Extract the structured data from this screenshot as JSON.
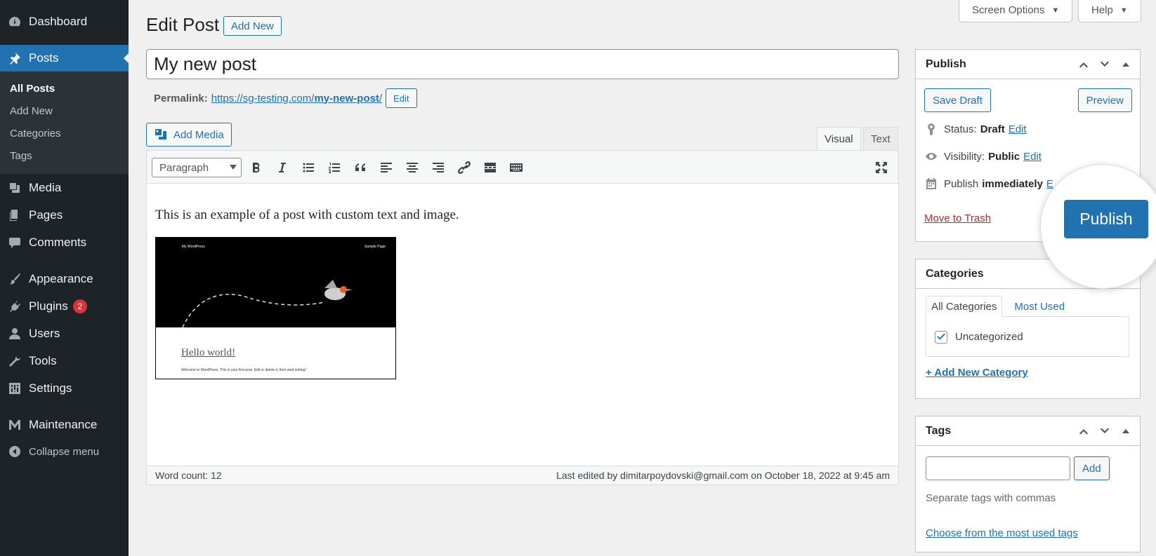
{
  "sidebar": {
    "dashboard": "Dashboard",
    "posts": "Posts",
    "submenu": [
      "All Posts",
      "Add New",
      "Categories",
      "Tags"
    ],
    "media": "Media",
    "pages": "Pages",
    "comments": "Comments",
    "appearance": "Appearance",
    "plugins": "Plugins",
    "plugins_badge": "2",
    "users": "Users",
    "tools": "Tools",
    "settings": "Settings",
    "maintenance": "Maintenance",
    "collapse": "Collapse menu"
  },
  "top": {
    "screen_options": "Screen Options",
    "help": "Help"
  },
  "header": {
    "title": "Edit Post",
    "add_new": "Add New"
  },
  "post": {
    "title": "My new post",
    "permalink_label": "Permalink:",
    "permalink_base": "https://sg-testing.com/",
    "permalink_slug": "my-new-post",
    "permalink_end": "/",
    "permalink_edit": "Edit"
  },
  "editor": {
    "add_media": "Add Media",
    "tab_visual": "Visual",
    "tab_text": "Text",
    "format": "Paragraph",
    "content": "This is an example of a post with custom text and image.",
    "image": {
      "site_name": "My WordPress",
      "sample_page": "Sample Page",
      "hello": "Hello world!",
      "welcome": "Welcome to WordPress. This is your first post. Edit or delete it, then start writing!"
    },
    "word_count": "Word count: 12",
    "last_edited": "Last edited by dimitarpoydovski@gmail.com on October 18, 2022 at 9:45 am"
  },
  "publish_box": {
    "title": "Publish",
    "save_draft": "Save Draft",
    "preview": "Preview",
    "status_label": "Status:",
    "status_value": "Draft",
    "visibility_label": "Visibility:",
    "visibility_value": "Public",
    "publish_label": "Publish",
    "publish_value": "immediately",
    "edit": "Edit",
    "edit_partial": "E",
    "trash": "Move to Trash",
    "publish_button": "Publish"
  },
  "categories_box": {
    "title": "Categories",
    "tab_all": "All Categories",
    "tab_most": "Most Used",
    "items": [
      {
        "label": "Uncategorized",
        "checked": true
      }
    ],
    "add_new": "+ Add New Category"
  },
  "tags_box": {
    "title": "Tags",
    "input_value": "",
    "add": "Add",
    "hint": "Separate tags with commas",
    "choose": "Choose from the most used tags"
  },
  "colors": {
    "accent": "#2271b1",
    "sidebar_bg": "#1d2327",
    "badge": "#d63638",
    "trash": "#b32d2e"
  }
}
